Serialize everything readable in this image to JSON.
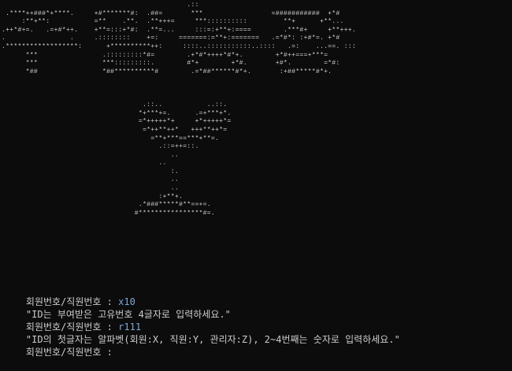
{
  "ascii_art": "                                              .::\n .****++###*+****.     +#*******#:  .##=       ***                 =###########  +*#\n     :**+**:           =**    .**.  .**+++=     ***::::::::::         **+      +**...\n.++*#+=.   .=+#*++.    +**=:::+*#:  .**=...     :::=:+**+:====        .***#+     +**+++.\n.                .     .::::::::    +=:     =======:=**+:=======   .=*#*: :+#*=. +*#\n.******************:      +**********++:     ::::..:::::::::::..::::   .=:    ...==. :::\n      ***                .:::::::::*#=        .+*#*++++*#*+.        +*#++===+***=\n      ***                ***:::::::::.        #*+        +*#.       +#*.        =*#:\n      *##                *##**********#        .=*##******#*+.       :+##*****#*+.\n\n\n\n                                   .::..           ..::.\n                                  *+***+=.      .=+***+*.\n                                  =*+++++*+     +*+++++*=\n                                   =*++**++*   +++**++*=\n                                     =**+***==***+**=.\n                                       .::=++=::.\n                                          ..\n                                       ..\n                                          :.\n                                          ..\n                                          ..\n                                       :+**+.\n                                  .*###*****#**==+=.\n                                 #****************#=.",
  "console": {
    "lines": [
      {
        "prompt": "회원번호/직원번호 : ",
        "input": "x10"
      },
      {
        "prompt": "\"ID는 부여받은 고유번호 4글자로 입력하세요.\"",
        "input": ""
      },
      {
        "prompt": "회원번호/직원번호 : ",
        "input": "r111"
      },
      {
        "prompt": "\"ID의 첫글자는 알파벳(회원:X, 직원:Y, 관리자:Z), 2~4번째는 숫자로 입력하세요.\"",
        "input": ""
      },
      {
        "prompt": "회원번호/직원번호 : ",
        "input": ""
      }
    ]
  },
  "colors": {
    "background": "#0c0c0c",
    "text": "#cccccc",
    "input": "#7fa7d9"
  }
}
